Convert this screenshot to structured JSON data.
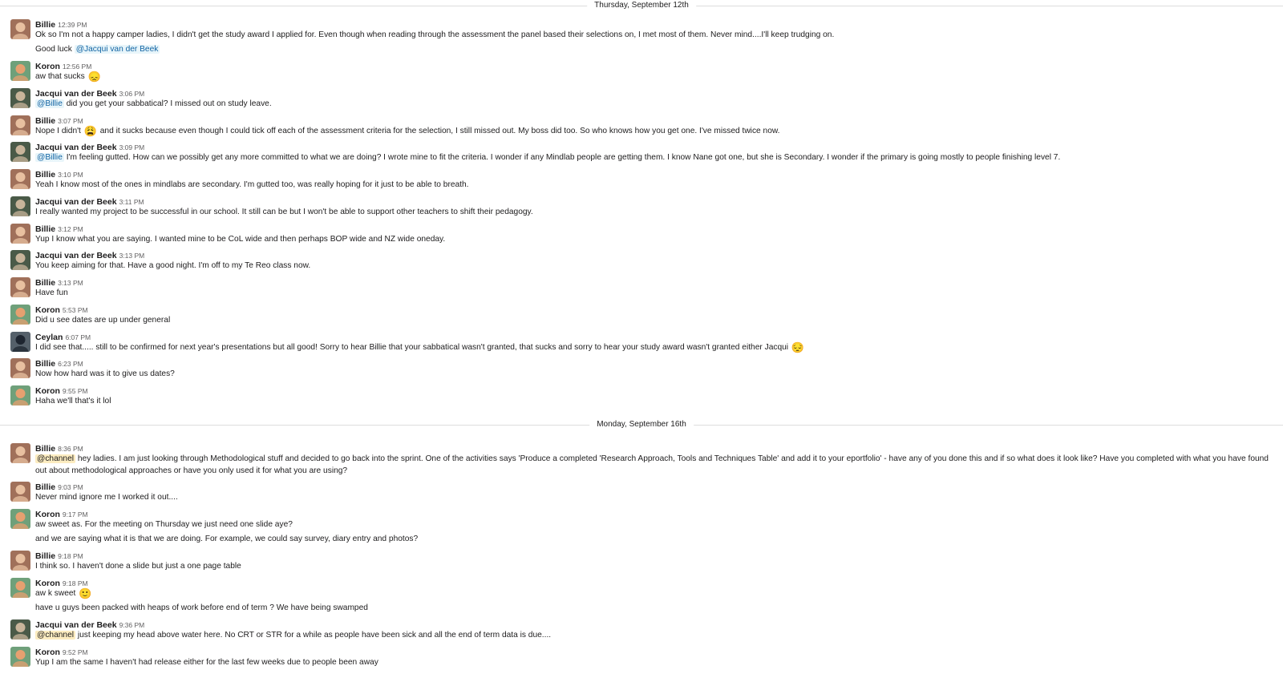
{
  "avatars": {
    "Billie": {
      "bg": "#a0705a",
      "fg": "#e8c0a0"
    },
    "Koron": {
      "bg": "#6fa07a",
      "fg": "#e6a070"
    },
    "Jacqui van der Beek": {
      "bg": "#4a5a48",
      "fg": "#c8b49a"
    },
    "Ceylan": {
      "bg": "#55606a",
      "fg": "#1e2530"
    }
  },
  "dividers": [
    "Thursday, September 12th",
    "Monday, September 16th"
  ],
  "messages": [
    {
      "name": "Billie",
      "time": "12:39 PM",
      "lines": [
        [
          {
            "t": "Ok so I'm not a happy camper ladies, I didn't get the study award I applied for. Even though when reading through the assessment the panel based their selections on, I met most of them. Never mind....I'll keep trudging on."
          }
        ],
        [
          {
            "t": "Good luck "
          },
          {
            "m": "@Jacqui van der Beek"
          }
        ]
      ]
    },
    {
      "name": "Koron",
      "time": "12:56 PM",
      "lines": [
        [
          {
            "t": "aw that sucks "
          },
          {
            "e": "😞"
          }
        ]
      ]
    },
    {
      "name": "Jacqui van der Beek",
      "time": "3:06 PM",
      "lines": [
        [
          {
            "m": "@Billie"
          },
          {
            "t": " did you get your sabbatical? I missed out on study leave."
          }
        ]
      ]
    },
    {
      "name": "Billie",
      "time": "3:07 PM",
      "lines": [
        [
          {
            "t": "Nope I didn't "
          },
          {
            "e": "😩"
          },
          {
            "t": " and it sucks because even though I could tick off each of the assessment criteria for the selection, I still missed out. My boss did too. So who knows how you get one. I've missed twice now."
          }
        ]
      ]
    },
    {
      "name": "Jacqui van der Beek",
      "time": "3:09 PM",
      "lines": [
        [
          {
            "m": "@Billie"
          },
          {
            "t": " I'm feeling gutted. How can we possibly get any more committed to what we are doing? I wrote mine to fit the criteria. I wonder if any Mindlab people are getting them. I know Nane got one, but she is Secondary. I wonder if the primary is going mostly to people finishing level 7."
          }
        ]
      ]
    },
    {
      "name": "Billie",
      "time": "3:10 PM",
      "lines": [
        [
          {
            "t": "Yeah I know most of the ones in mindlabs are secondary. I'm gutted too, was really hoping for it just to be able to breath."
          }
        ]
      ]
    },
    {
      "name": "Jacqui van der Beek",
      "time": "3:11 PM",
      "lines": [
        [
          {
            "t": "I really wanted my project to be successful in our school. It still can be but I won't be able to support other teachers to shift their pedagogy."
          }
        ]
      ]
    },
    {
      "name": "Billie",
      "time": "3:12 PM",
      "lines": [
        [
          {
            "t": "Yup I know what you are saying. I wanted mine to be CoL wide and then perhaps BOP wide and NZ wide oneday."
          }
        ]
      ]
    },
    {
      "name": "Jacqui van der Beek",
      "time": "3:13 PM",
      "lines": [
        [
          {
            "t": "You keep aiming for that. Have a good night. I'm off to my Te Reo class now."
          }
        ]
      ]
    },
    {
      "name": "Billie",
      "time": "3:13 PM",
      "lines": [
        [
          {
            "t": "Have fun"
          }
        ]
      ]
    },
    {
      "name": "Koron",
      "time": "5:53 PM",
      "lines": [
        [
          {
            "t": "Did u see dates are up under general"
          }
        ]
      ]
    },
    {
      "name": "Ceylan",
      "time": "6:07 PM",
      "lines": [
        [
          {
            "t": "I did see that..... still to be confirmed for next year's presentations but all good! Sorry to hear Billie that your sabbatical wasn't granted, that sucks and sorry to hear your study award wasn't granted either Jacqui "
          },
          {
            "e": "😔"
          }
        ]
      ]
    },
    {
      "name": "Billie",
      "time": "6:23 PM",
      "lines": [
        [
          {
            "t": "Now how hard was it to give us dates?"
          }
        ]
      ]
    },
    {
      "name": "Koron",
      "time": "9:55 PM",
      "lines": [
        [
          {
            "t": "Haha we'll that's it lol"
          }
        ]
      ]
    },
    {
      "name": "Billie",
      "time": "8:36 PM",
      "lines": [
        [
          {
            "c": "@channel"
          },
          {
            "t": " hey ladies. I am just looking through Methodological stuff and decided to go back into the sprint. One of the activities says 'Produce a completed 'Research Approach, Tools and Techniques Table' and add it to your eportfolio' - have any of you done this and if so what does it look like? Have you completed with what you have found out about methodological approaches or have you only used it for what you are using?"
          }
        ]
      ]
    },
    {
      "name": "Billie",
      "time": "9:03 PM",
      "lines": [
        [
          {
            "t": "Never mind ignore me I worked it out...."
          }
        ]
      ]
    },
    {
      "name": "Koron",
      "time": "9:17 PM",
      "lines": [
        [
          {
            "t": "aw sweet as. For the meeting on Thursday we just need one slide aye?"
          }
        ],
        [
          {
            "t": "and we are saying what it is that we are doing. For example, we could say survey, diary entry and photos?"
          }
        ]
      ]
    },
    {
      "name": "Billie",
      "time": "9:18 PM",
      "lines": [
        [
          {
            "t": "I think so. I haven't done a slide but just a one page table"
          }
        ]
      ]
    },
    {
      "name": "Koron",
      "time": "9:18 PM",
      "lines": [
        [
          {
            "t": "aw k sweet "
          },
          {
            "e": "🙂"
          }
        ],
        [
          {
            "t": "have u guys been packed with heaps of work before end of term ? We have being swamped"
          }
        ]
      ]
    },
    {
      "name": "Jacqui van der Beek",
      "time": "9:36 PM",
      "lines": [
        [
          {
            "c": "@channel"
          },
          {
            "t": " just keeping my head above water here. No CRT or STR for a while as people have been sick and all the end of term data is due...."
          }
        ]
      ]
    },
    {
      "name": "Koron",
      "time": "9:52 PM",
      "lines": [
        [
          {
            "t": "Yup I am the same I haven't had release either for the last few weeks due to people been away"
          }
        ]
      ]
    }
  ]
}
